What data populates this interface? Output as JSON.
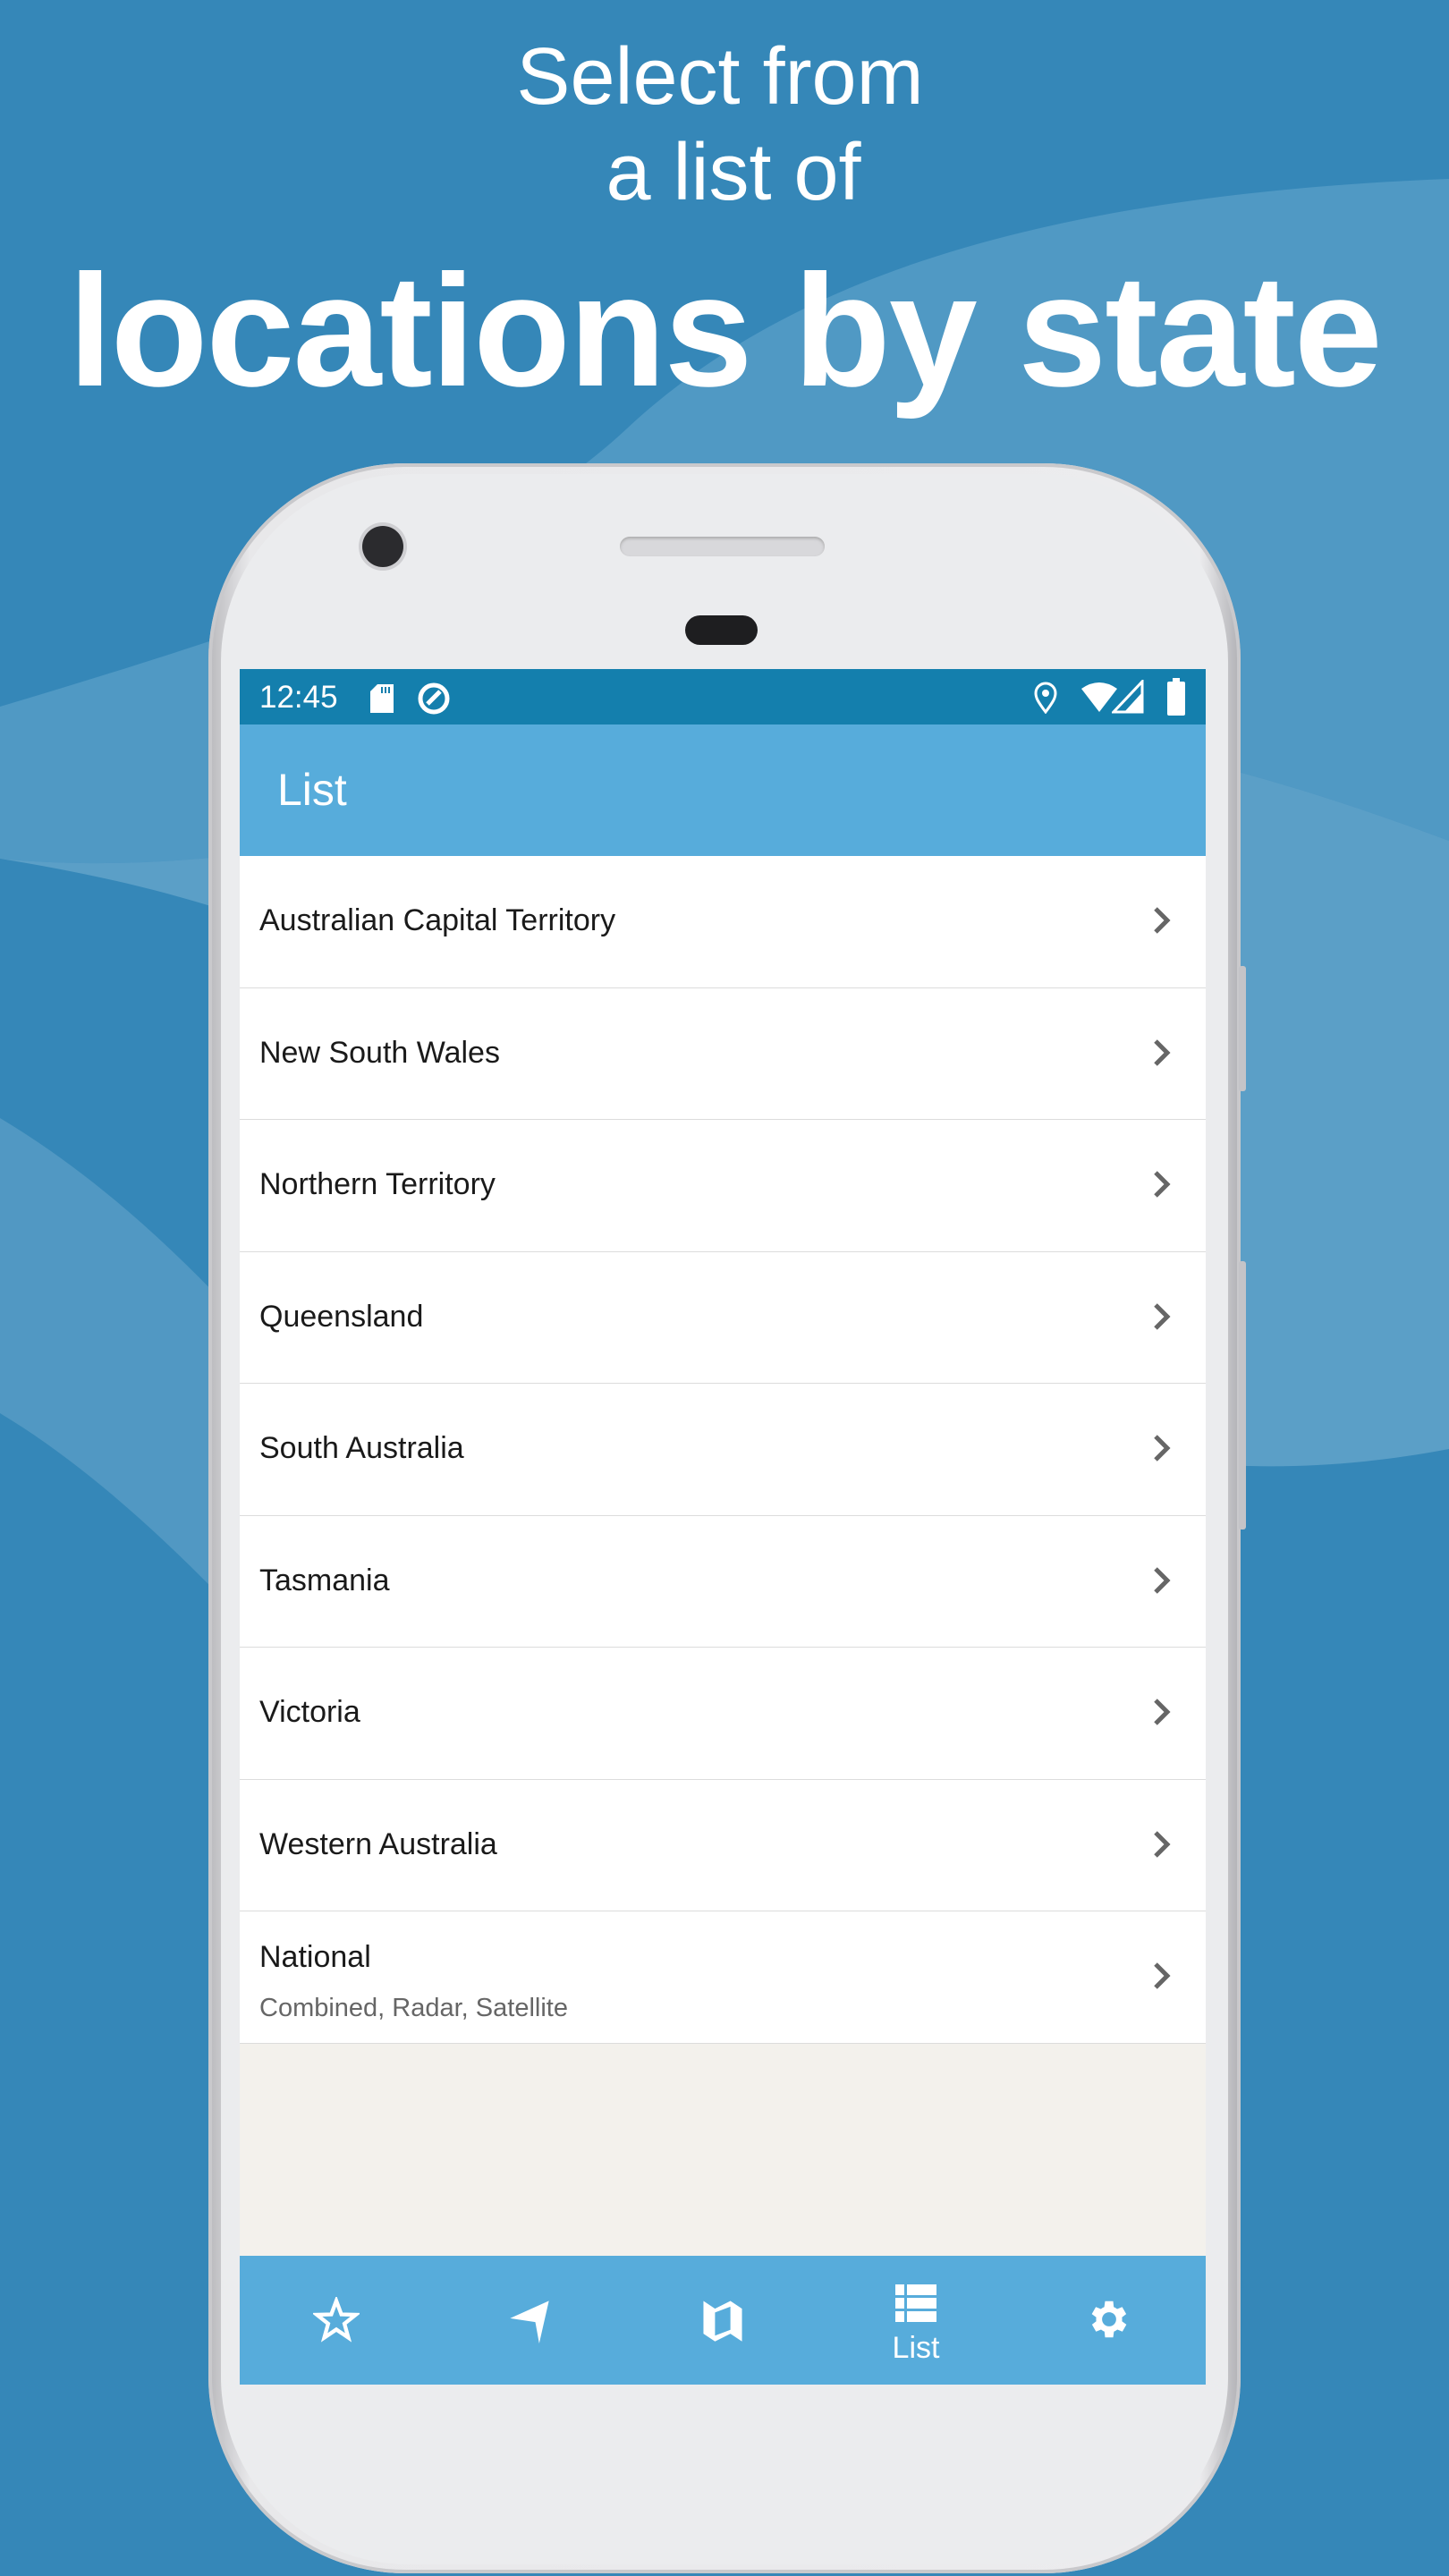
{
  "promo": {
    "line1": "Select from",
    "line2": "a list of",
    "line3": "locations by state"
  },
  "status_bar": {
    "time": "12:45",
    "left_icons": [
      "sd-card-icon",
      "data-saver-icon"
    ],
    "right_icons": [
      "location-icon",
      "wifi-icon",
      "signal-icon",
      "battery-icon"
    ]
  },
  "app_bar": {
    "title": "List"
  },
  "list": {
    "items": [
      {
        "label": "Australian Capital Territory"
      },
      {
        "label": "New South Wales"
      },
      {
        "label": "Northern Territory"
      },
      {
        "label": "Queensland"
      },
      {
        "label": "South Australia"
      },
      {
        "label": "Tasmania"
      },
      {
        "label": "Victoria"
      },
      {
        "label": "Western Australia"
      },
      {
        "label": "National",
        "sublabel": "Combined, Radar, Satellite"
      }
    ]
  },
  "bottom_nav": {
    "items": [
      {
        "icon": "star-icon",
        "label": ""
      },
      {
        "icon": "navigation-icon",
        "label": ""
      },
      {
        "icon": "map-icon",
        "label": ""
      },
      {
        "icon": "list-icon",
        "label": "List",
        "active": true
      },
      {
        "icon": "gear-icon",
        "label": ""
      }
    ]
  },
  "colors": {
    "background": "#3587b8",
    "status_bar": "#147fad",
    "app_bar": "#57acdb",
    "list_bg": "#f3f1ec"
  }
}
